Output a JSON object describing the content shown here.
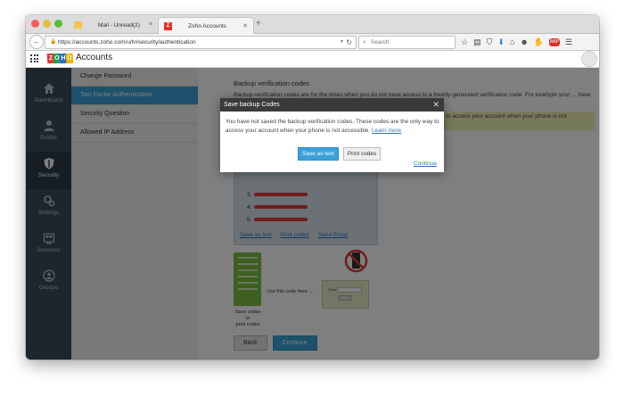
{
  "browser": {
    "tabs": [
      {
        "label": "Mail - Unread(2)",
        "active": false
      },
      {
        "label": "Zoho Accounts",
        "active": true
      }
    ],
    "url": "https://accounts.zoho.com/u/h#security/authentication",
    "search_placeholder": "Search"
  },
  "app": {
    "title": "Accounts",
    "logo_letters": [
      "Z",
      "O",
      "H",
      "O"
    ],
    "logo_colors": [
      "#e4322b",
      "#1f9d55",
      "#2b6ac9",
      "#f4b400"
    ]
  },
  "iconbar": {
    "items": [
      {
        "label": "Dashboard",
        "icon": "home-icon"
      },
      {
        "label": "Profile",
        "icon": "person-icon"
      },
      {
        "label": "Security",
        "icon": "shield-icon"
      },
      {
        "label": "Settings",
        "icon": "gear-icon"
      },
      {
        "label": "Sessions",
        "icon": "sessions-icon"
      },
      {
        "label": "Groups",
        "icon": "groups-icon"
      }
    ],
    "active": "Security"
  },
  "settings_list": {
    "items": [
      "Change Password",
      "Two Factor Authentication",
      "Security Question",
      "Allowed IP Address"
    ],
    "active": "Two Factor Authentication"
  },
  "main": {
    "title": "Backup verification codes",
    "description": "Backup verification codes are for the times when you do not have access to a freshly generated verification code. For example your ... have no power back up for your phone.",
    "warning": "You have not saved the backup verification codes. These codes are the only way to access your account when your phone is not accessible.",
    "code_numbers": [
      "3.",
      "4.",
      "5."
    ],
    "codes_actions": [
      "Save as text",
      "Print codes",
      "Send Email"
    ],
    "illustration": {
      "caption_lines": [
        "Save codes",
        "or",
        "print codes"
      ],
      "use_code_label": "Use this code here",
      "phone_label": "Code"
    },
    "buttons": {
      "back": "Back",
      "continue": "Continue"
    }
  },
  "modal": {
    "title": "Save backup Codes",
    "text": "You have not saved the backup verification codes. These codes are the only way to access your account when your phone is not accessible.",
    "learn_more": "Learn more",
    "primary_button": "Save as text",
    "secondary_button": "Print codes",
    "continue_link": "Continue"
  },
  "colors": {
    "accent": "#3aa2d8",
    "sidebar": "#3b4d5a",
    "warning_bg": "#eef3b6"
  }
}
